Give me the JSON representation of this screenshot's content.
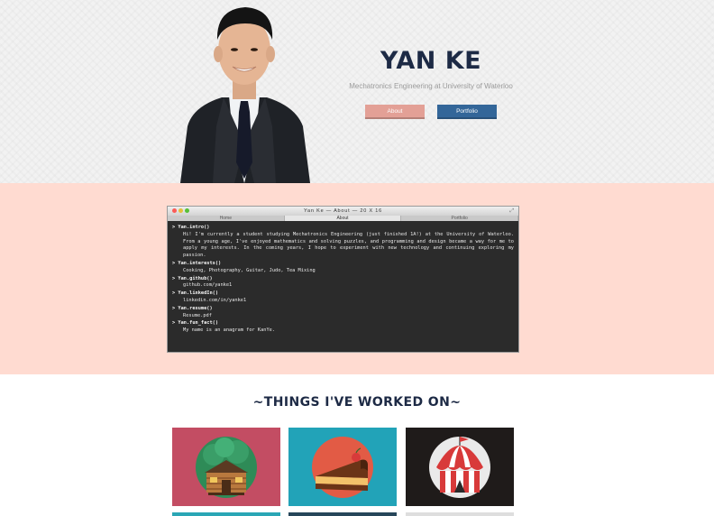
{
  "hero": {
    "name": "YAN KE",
    "subtitle": "Mechatronics Engineering at University of Waterloo",
    "buttons": {
      "about": "About",
      "portfolio": "Portfolio"
    },
    "colors": {
      "background": "#f2f2f2",
      "name": "#1d2a45",
      "about_button": "#e3a096",
      "portfolio_button": "#336699"
    }
  },
  "terminal": {
    "title": "Yan Ke — About — 20 X 16",
    "tabs": [
      "Home",
      "About",
      "Portfolio"
    ],
    "active_tab": "About",
    "lines": [
      {
        "cmd": "> Yan.intro()",
        "out": "Hi! I'm currently a student studying Mechatronics Engineering (just finished 1A!) at the University of Waterloo. From a young age, I've enjoyed mathematics and solving puzzles, and programming and design became a way for me to apply my interests. In the coming years, I hope to experiment with new technology and continuing exploring my passion."
      },
      {
        "cmd": "> Yan.interests()",
        "out": "Cooking, Photography, Guitar, Judo, Tea Mixing"
      },
      {
        "cmd": "> Yan.github()",
        "out": "github.com/yanke1"
      },
      {
        "cmd": "> Yan.linkedIn()",
        "out": "linkedin.com/in/yanke1"
      },
      {
        "cmd": "> Yan.resume()",
        "out": "Resume.pdf"
      },
      {
        "cmd": "> Yan.fun_fact()",
        "out": "My name is an anagram for KanYe."
      }
    ],
    "colors": {
      "band": "#ffdbd1",
      "screen": "#2b2b2b"
    }
  },
  "projects": {
    "heading": "~THINGS I'VE WORKED ON~",
    "tiles": [
      {
        "icon": "log-cabin-icon",
        "color": "#c34d63"
      },
      {
        "icon": "cake-slice-icon",
        "color": "#22a3b8"
      },
      {
        "icon": "circus-tent-icon",
        "color": "#1f1b1a"
      }
    ]
  }
}
